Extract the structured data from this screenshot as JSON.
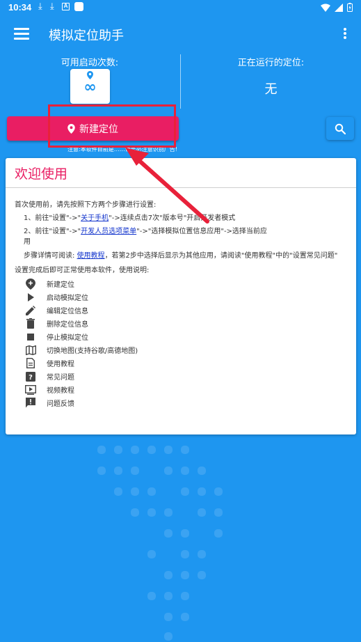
{
  "status_bar": {
    "time": "10:34",
    "icon_a": "A"
  },
  "app_bar": {
    "title": "模拟定位助手"
  },
  "stats": {
    "available_label": "可用启动次数:",
    "available_value": "∞",
    "running_label": "正在运行的定位:",
    "running_value": "无"
  },
  "actions": {
    "new_location_label": "新建定位",
    "notice": "注意:本软件目前是……请务必注意识别广告!"
  },
  "welcome": {
    "title": "欢迎使用",
    "intro": "首次使用前，请先按照下方两个步骤进行设置:",
    "step1_prefix": "1、前往\"设置\"->\"",
    "step1_link": "关于手机",
    "step1_suffix": "\"->连续点击7次\"版本号\"开启开发者模式",
    "step2_prefix": "2、前往\"设置\"->\"",
    "step2_link": "开发人员选项菜单",
    "step2_suffix": "\"->\"选择模拟位置信息应用\"->选择当前应",
    "step2_cont": "用",
    "detail_prefix": "步骤详情可阅读: ",
    "detail_link": "使用教程",
    "detail_suffix": "，若第2步中选择后显示为其他应用，请阅读\"使用教程\"中的\"设置常见问题\"",
    "usage_heading": "设置完成后即可正常使用本软件，使用说明:",
    "features": [
      {
        "icon": "add-location-icon",
        "label": "新建定位"
      },
      {
        "icon": "play-icon",
        "label": "启动模拟定位"
      },
      {
        "icon": "edit-icon",
        "label": "编辑定位信息"
      },
      {
        "icon": "delete-icon",
        "label": "删除定位信息"
      },
      {
        "icon": "stop-icon",
        "label": "停止模拟定位"
      },
      {
        "icon": "map-icon",
        "label": "切换地图(支持谷歌/高德地图)"
      },
      {
        "icon": "document-icon",
        "label": "使用教程"
      },
      {
        "icon": "question-icon",
        "label": "常见问题"
      },
      {
        "icon": "video-icon",
        "label": "视频教程"
      },
      {
        "icon": "feedback-icon",
        "label": "问题反馈"
      }
    ]
  },
  "colors": {
    "primary": "#1e96f0",
    "accent": "#e91e63",
    "annotation": "#e8213a",
    "link": "#1133cc"
  }
}
